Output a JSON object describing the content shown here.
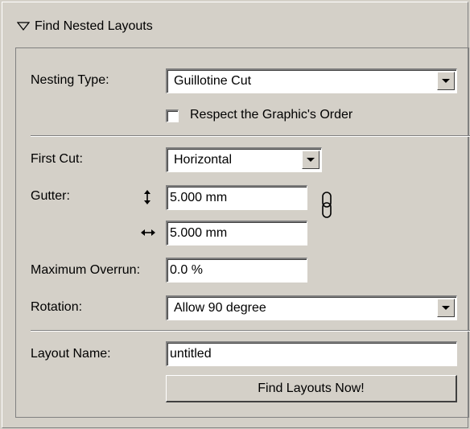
{
  "section": {
    "title": "Find Nested Layouts"
  },
  "form": {
    "nesting_type": {
      "label": "Nesting Type:",
      "value": "Guillotine Cut"
    },
    "respect_order": {
      "label": "Respect the Graphic's Order",
      "checked": false
    },
    "first_cut": {
      "label": "First Cut:",
      "value": "Horizontal"
    },
    "gutter": {
      "label": "Gutter:",
      "vertical_value": "5.000 mm",
      "horizontal_value": "5.000 mm",
      "vertical_icon": "vertical-arrows-icon",
      "horizontal_icon": "horizontal-arrows-icon",
      "link_icon": "chain-link-icon"
    },
    "maximum_overrun": {
      "label": "Maximum Overrun:",
      "value": "0.0 %"
    },
    "rotation": {
      "label": "Rotation:",
      "value": "Allow 90 degree"
    },
    "layout_name": {
      "label": "Layout Name:",
      "value": "untitled"
    },
    "find_button": {
      "label": "Find Layouts Now!"
    }
  },
  "colors": {
    "panel_bg": "#d4d0c8",
    "field_bg": "#ffffff",
    "shadow": "#808080",
    "dark_shadow": "#404040",
    "highlight": "#ffffff"
  }
}
